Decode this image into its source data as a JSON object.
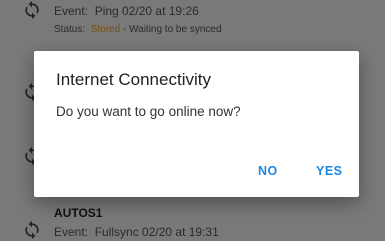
{
  "list": {
    "items": [
      {
        "title": "",
        "event_label": "Event:",
        "event_text": "Ping  02/20 at 19:26",
        "status_label": "Status:",
        "status_value": "Stored",
        "status_detail": " - Waiting to be synced"
      },
      {
        "title": "AUTOS1",
        "event_label": "Event:",
        "event_text": "Fullsync  02/20 at 19:31"
      }
    ]
  },
  "dialog": {
    "title": "Internet Connectivity",
    "message": "Do you want to go online now?",
    "no_label": "NO",
    "yes_label": "YES"
  },
  "colors": {
    "accent": "#1e88e5",
    "status_stored": "#f0a020",
    "scrim": "rgba(0,0,0,0.5)"
  },
  "icons": {
    "list_item_icon": "sync-icon"
  }
}
